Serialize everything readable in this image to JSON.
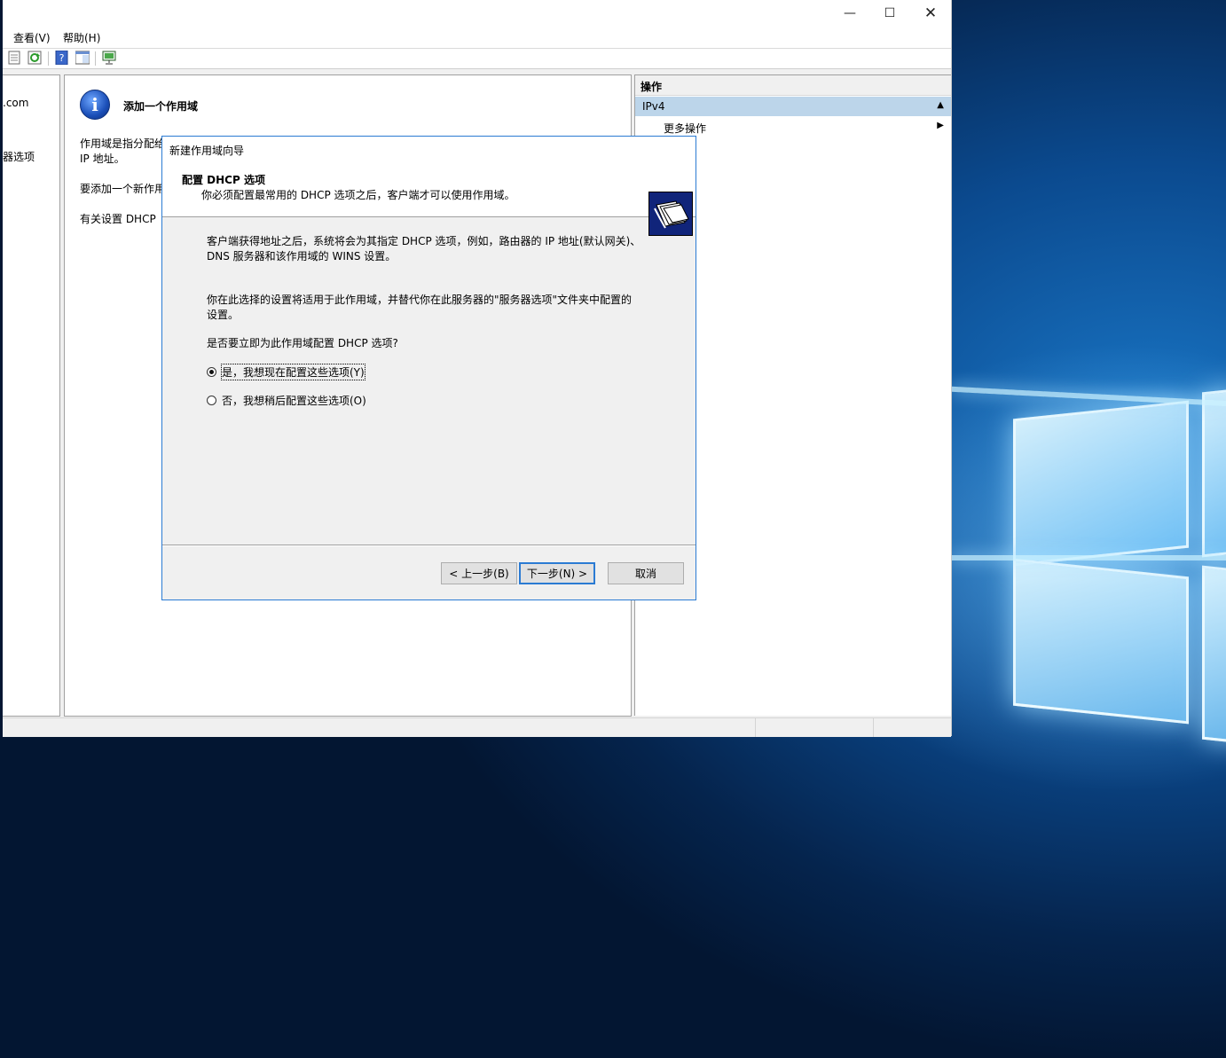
{
  "main_window": {
    "left_tree": {
      "items": [
        ".com",
        "器选项"
      ]
    },
    "menu": {
      "view": "查看(V)",
      "help": "帮助(H)"
    },
    "toolbar_icons": [
      "properties-icon",
      "refresh-icon",
      "help-icon",
      "show-hide-pane-icon",
      "server-icon"
    ],
    "center": {
      "title": "添加一个作用域",
      "line1a": "作用域是指分配给",
      "line1b": "IP 地址。",
      "line2": "要添加一个新作用",
      "line3": "有关设置 DHCP"
    },
    "actions": {
      "header": "操作",
      "section": "IPv4",
      "more": "更多操作"
    }
  },
  "dialog": {
    "title": "新建作用域向导",
    "header_title": "配置 DHCP 选项",
    "header_subtitle": "你必须配置最常用的 DHCP 选项之后，客户端才可以使用作用域。",
    "para1_line1": "客户端获得地址之后，系统将会为其指定 DHCP 选项，例如，路由器的 IP 地址(默认网关)、",
    "para1_line2": "DNS 服务器和该作用域的 WINS 设置。",
    "para2_line1": "你在此选择的设置将适用于此作用域，并替代你在此服务器的\"服务器选项\"文件夹中配置的",
    "para2_line2": "设置。",
    "question": "是否要立即为此作用域配置 DHCP 选项?",
    "options": [
      {
        "label": "是，我想现在配置这些选项(Y)",
        "selected": true
      },
      {
        "label": "否，我想稍后配置这些选项(O)",
        "selected": false
      }
    ],
    "buttons": {
      "back": "< 上一步(B)",
      "next": "下一步(N) >",
      "cancel": "取消"
    }
  },
  "colors": {
    "accent": "#2b7bd3",
    "selection": "#bcd5ea",
    "desktop": "#0b4a8f"
  }
}
